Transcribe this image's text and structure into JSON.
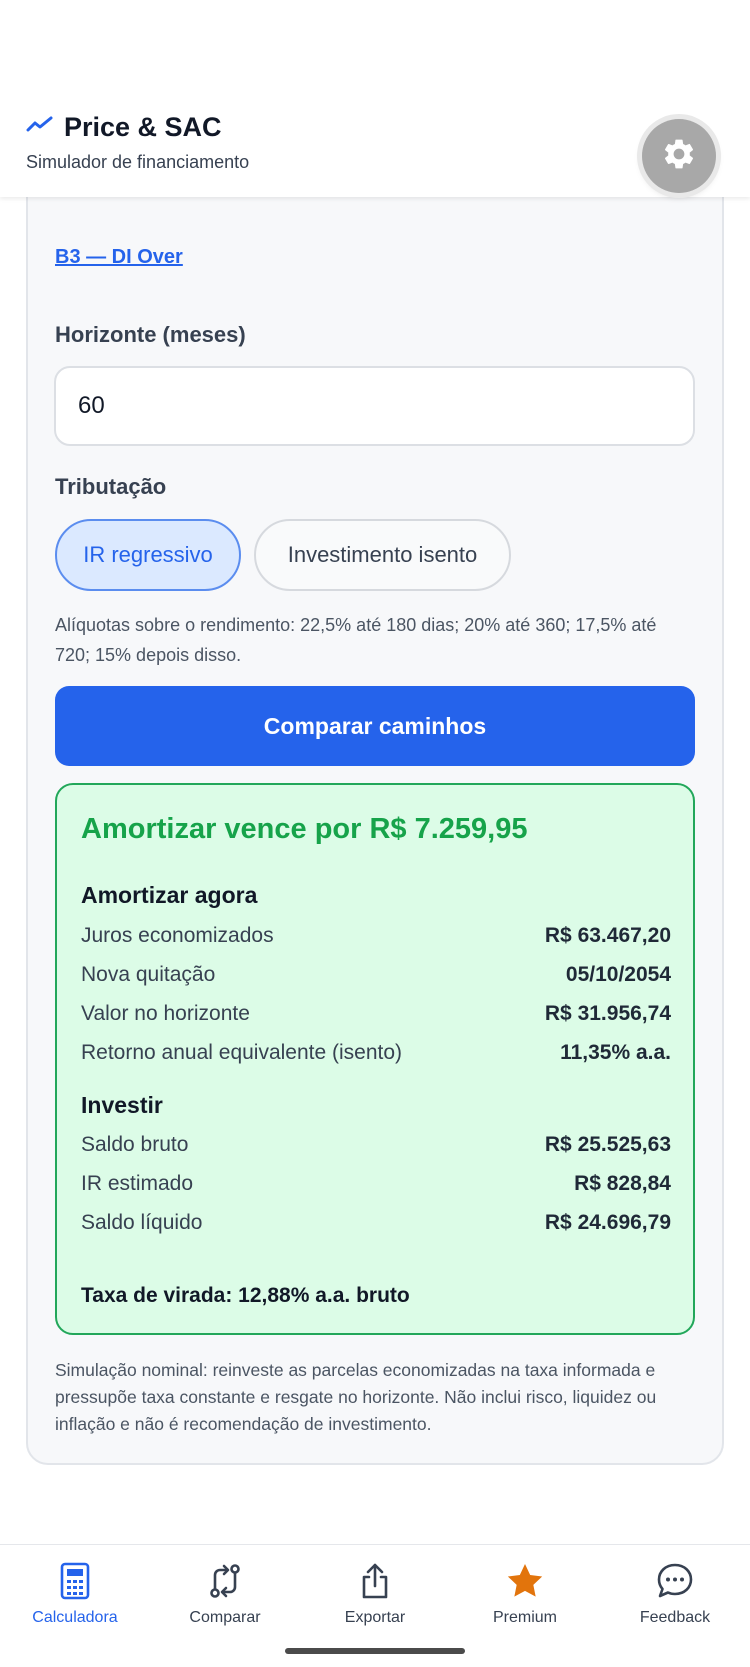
{
  "header": {
    "title": "Price & SAC",
    "subtitle": "Simulador de financiamento"
  },
  "form": {
    "source_link": "B3 — DI Over",
    "horizon_label": "Horizonte (meses)",
    "horizon_value": "60",
    "tax_label": "Tributação",
    "tax_options": [
      {
        "label": "IR regressivo",
        "selected": true
      },
      {
        "label": "Investimento isento",
        "selected": false
      }
    ],
    "tax_help": "Alíquotas sobre o rendimento: 22,5% até 180 dias; 20% até 360; 17,5% até 720; 15% depois disso.",
    "compare_button": "Comparar caminhos"
  },
  "result": {
    "headline": "Amortizar vence por R$ 7.259,95",
    "amortize": {
      "title": "Amortizar agora",
      "rows": [
        {
          "label": "Juros economizados",
          "value": "R$ 63.467,20"
        },
        {
          "label": "Nova quitação",
          "value": "05/10/2054"
        },
        {
          "label": "Valor no horizonte",
          "value": "R$ 31.956,74"
        },
        {
          "label": "Retorno anual equivalente (isento)",
          "value": "11,35% a.a."
        }
      ]
    },
    "invest": {
      "title": "Investir",
      "rows": [
        {
          "label": "Saldo bruto",
          "value": "R$ 25.525,63"
        },
        {
          "label": "IR estimado",
          "value": "R$ 828,84"
        },
        {
          "label": "Saldo líquido",
          "value": "R$ 24.696,79"
        }
      ]
    },
    "breakeven": "Taxa de virada: 12,88% a.a. bruto"
  },
  "disclaimer": "Simulação nominal: reinveste as parcelas economizadas na taxa informada e pressupõe taxa constante e resgate no horizonte. Não inclui risco, liquidez ou inflação e não é recomendação de investimento.",
  "nav": {
    "items": [
      {
        "label": "Calculadora",
        "icon": "calculator-icon",
        "active": true
      },
      {
        "label": "Comparar",
        "icon": "compare-icon",
        "active": false
      },
      {
        "label": "Exportar",
        "icon": "share-icon",
        "active": false
      },
      {
        "label": "Premium",
        "icon": "star-icon",
        "active": false
      },
      {
        "label": "Feedback",
        "icon": "chat-icon",
        "active": false
      }
    ]
  },
  "colors": {
    "accent": "#2563eb",
    "success": "#16a34a",
    "success_bg": "#dcfce7",
    "premium": "#e2740c"
  }
}
